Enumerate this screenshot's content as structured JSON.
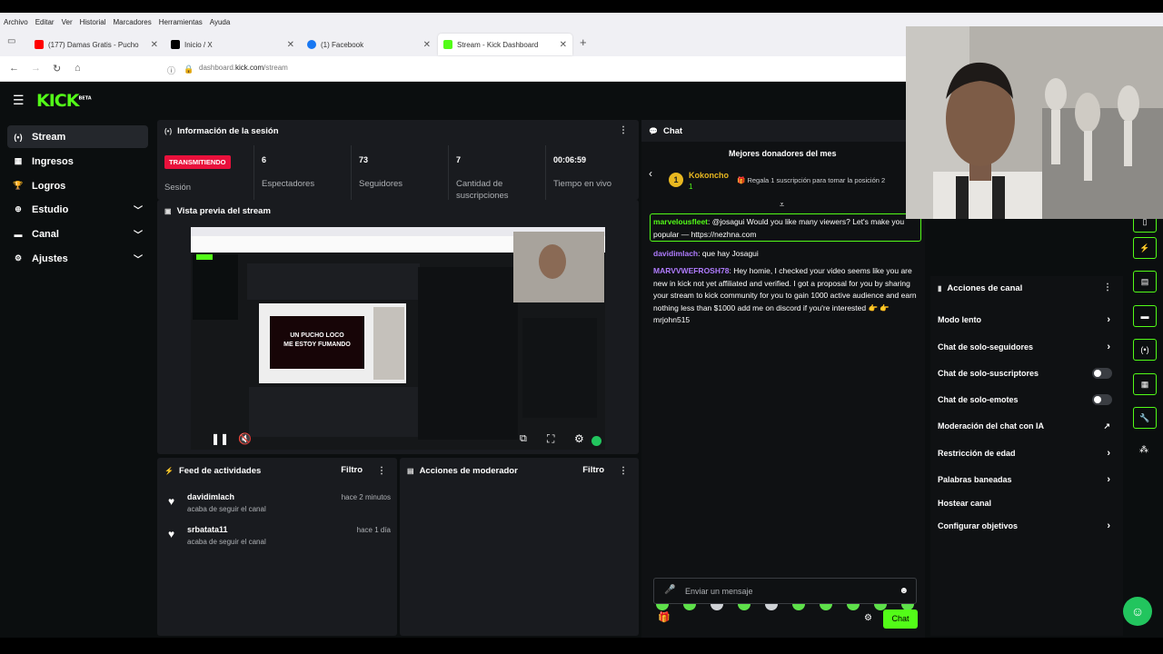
{
  "menubar": [
    "Archivo",
    "Editar",
    "Ver",
    "Historial",
    "Marcadores",
    "Herramientas",
    "Ayuda"
  ],
  "tabs": [
    {
      "label": "(177) Damas Gratis - Pucho",
      "icon_color": "#ff0000"
    },
    {
      "label": "Inicio / X",
      "icon_color": "#000000"
    },
    {
      "label": "(1) Facebook",
      "icon_color": "#1877f2"
    },
    {
      "label": "Stream - Kick Dashboard",
      "icon_color": "#53fc18"
    }
  ],
  "address": {
    "pre": "dashboard.",
    "domain": "kick.com",
    "post": "/stream"
  },
  "brand": {
    "logo": "KICK",
    "badge": "BETA",
    "accent": "#53fc18"
  },
  "sidebar": [
    {
      "label": "Stream",
      "icon": "broadcast-icon"
    },
    {
      "label": "Ingresos",
      "icon": "chart-icon"
    },
    {
      "label": "Logros",
      "icon": "trophy-icon"
    },
    {
      "label": "Estudio",
      "icon": "studio-icon"
    },
    {
      "label": "Canal",
      "icon": "channel-icon"
    },
    {
      "label": "Ajustes",
      "icon": "gear-icon"
    }
  ],
  "session": {
    "title": "Información de la sesión",
    "status": "TRANSMITIENDO",
    "status_label": "Sesión",
    "stats": [
      {
        "value": "6",
        "label": "Espectadores"
      },
      {
        "value": "73",
        "label": "Seguidores"
      },
      {
        "value": "7",
        "label": "Cantidad de suscripciones"
      },
      {
        "value": "00:06:59",
        "label": "Tiempo en vivo"
      }
    ]
  },
  "preview": {
    "title": "Vista previa del stream"
  },
  "feed": {
    "title": "Feed de actividades",
    "filter": "Filtro",
    "items": [
      {
        "user": "davidimlach",
        "action": "acaba de seguir el canal",
        "time": "hace 2 minutos"
      },
      {
        "user": "srbatata11",
        "action": "acaba de seguir el canal",
        "time": "hace 1 día"
      }
    ]
  },
  "mod": {
    "title": "Acciones de moderador",
    "filter": "Filtro"
  },
  "chat": {
    "title": "Chat",
    "donors_title": "Mejores donadores del mes",
    "donor_name": "Kokoncho",
    "donor_count": "1",
    "donor_cta": "Regala 1 suscripción para tomar la posición 2",
    "messages": [
      {
        "user": "marvelousfleet",
        "color": "#53fc18",
        "text": "@josagui Would you like many viewers? Let's make you popular — https://nezhna.com"
      },
      {
        "user": "davidimlach",
        "color": "#b07cff",
        "text": "que hay Josagui"
      },
      {
        "user": "MARVVWEFROSH78",
        "color": "#b07cff",
        "text": "Hey homie, I checked your video seems like you are new in kick not yet affiliated and verified. I got a proposal for you by sharing your stream to kick community for you to gain 1000 active audience and earn nothing less than $1000 add me on discord if you're interested 👉 👉 mrjohn515"
      }
    ],
    "input_placeholder": "Enviar un mensaje",
    "send_label": "Chat"
  },
  "channel_actions": {
    "title": "Acciones de canal",
    "rows": [
      {
        "label": "Modo lento",
        "kind": "arrow"
      },
      {
        "label": "Chat de solo-seguidores",
        "kind": "arrow"
      },
      {
        "label": "Chat de solo-suscriptores",
        "kind": "toggle"
      },
      {
        "label": "Chat de solo-emotes",
        "kind": "toggle"
      },
      {
        "label": "Moderación del chat con IA",
        "kind": "external"
      },
      {
        "label": "Restricción de edad",
        "kind": "arrow"
      },
      {
        "label": "Palabras baneadas",
        "kind": "arrow"
      },
      {
        "label": "Hostear canal",
        "kind": "none"
      },
      {
        "label": "Configurar objetivos",
        "kind": "arrow"
      }
    ]
  },
  "preview_overlay": {
    "line1": "UN PUCHO LOCO",
    "line2": "ME ESTOY FUMANDO"
  }
}
